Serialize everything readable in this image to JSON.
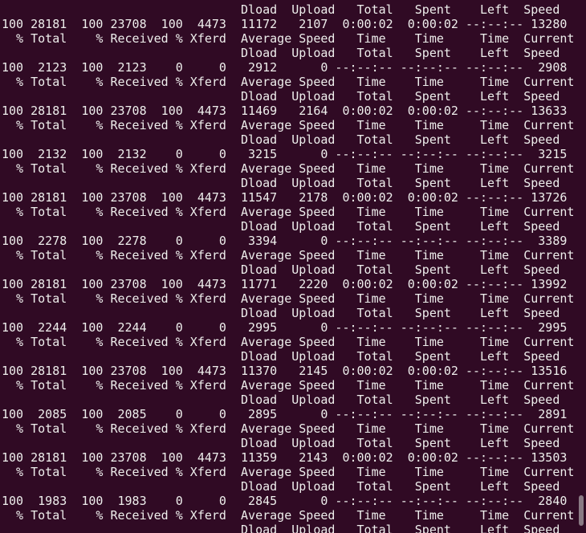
{
  "terminal": {
    "lines": [
      "                                 Dload  Upload   Total   Spent    Left  Speed",
      "100 28181  100 23708  100  4473  11172   2107  0:00:02  0:00:02 --:--:-- 13280",
      "  % Total    % Received % Xferd  Average Speed   Time    Time     Time  Current",
      "                                 Dload  Upload   Total   Spent    Left  Speed",
      "100  2123  100  2123    0     0   2912      0 --:--:-- --:--:-- --:--:--  2908",
      "  % Total    % Received % Xferd  Average Speed   Time    Time     Time  Current",
      "                                 Dload  Upload   Total   Spent    Left  Speed",
      "100 28181  100 23708  100  4473  11469   2164  0:00:02  0:00:02 --:--:-- 13633",
      "  % Total    % Received % Xferd  Average Speed   Time    Time     Time  Current",
      "                                 Dload  Upload   Total   Spent    Left  Speed",
      "100  2132  100  2132    0     0   3215      0 --:--:-- --:--:-- --:--:--  3215",
      "  % Total    % Received % Xferd  Average Speed   Time    Time     Time  Current",
      "                                 Dload  Upload   Total   Spent    Left  Speed",
      "100 28181  100 23708  100  4473  11547   2178  0:00:02  0:00:02 --:--:-- 13726",
      "  % Total    % Received % Xferd  Average Speed   Time    Time     Time  Current",
      "                                 Dload  Upload   Total   Spent    Left  Speed",
      "100  2278  100  2278    0     0   3394      0 --:--:-- --:--:-- --:--:--  3389",
      "  % Total    % Received % Xferd  Average Speed   Time    Time     Time  Current",
      "                                 Dload  Upload   Total   Spent    Left  Speed",
      "100 28181  100 23708  100  4473  11771   2220  0:00:02  0:00:02 --:--:-- 13992",
      "  % Total    % Received % Xferd  Average Speed   Time    Time     Time  Current",
      "                                 Dload  Upload   Total   Spent    Left  Speed",
      "100  2244  100  2244    0     0   2995      0 --:--:-- --:--:-- --:--:--  2995",
      "  % Total    % Received % Xferd  Average Speed   Time    Time     Time  Current",
      "                                 Dload  Upload   Total   Spent    Left  Speed",
      "100 28181  100 23708  100  4473  11370   2145  0:00:02  0:00:02 --:--:-- 13516",
      "  % Total    % Received % Xferd  Average Speed   Time    Time     Time  Current",
      "                                 Dload  Upload   Total   Spent    Left  Speed",
      "100  2085  100  2085    0     0   2895      0 --:--:-- --:--:-- --:--:--  2891",
      "  % Total    % Received % Xferd  Average Speed   Time    Time     Time  Current",
      "                                 Dload  Upload   Total   Spent    Left  Speed",
      "100 28181  100 23708  100  4473  11359   2143  0:00:02  0:00:02 --:--:-- 13503",
      "  % Total    % Received % Xferd  Average Speed   Time    Time     Time  Current",
      "                                 Dload  Upload   Total   Spent    Left  Speed",
      "100  1983  100  1983    0     0   2845      0 --:--:-- --:--:-- --:--:--  2840",
      "  % Total    % Received % Xferd  Average Speed   Time    Time     Time  Current",
      "                                 Dload  Upload   Total   Spent    Left  Speed"
    ]
  },
  "colors": {
    "background": "#300a24",
    "text": "#eeeeec"
  }
}
